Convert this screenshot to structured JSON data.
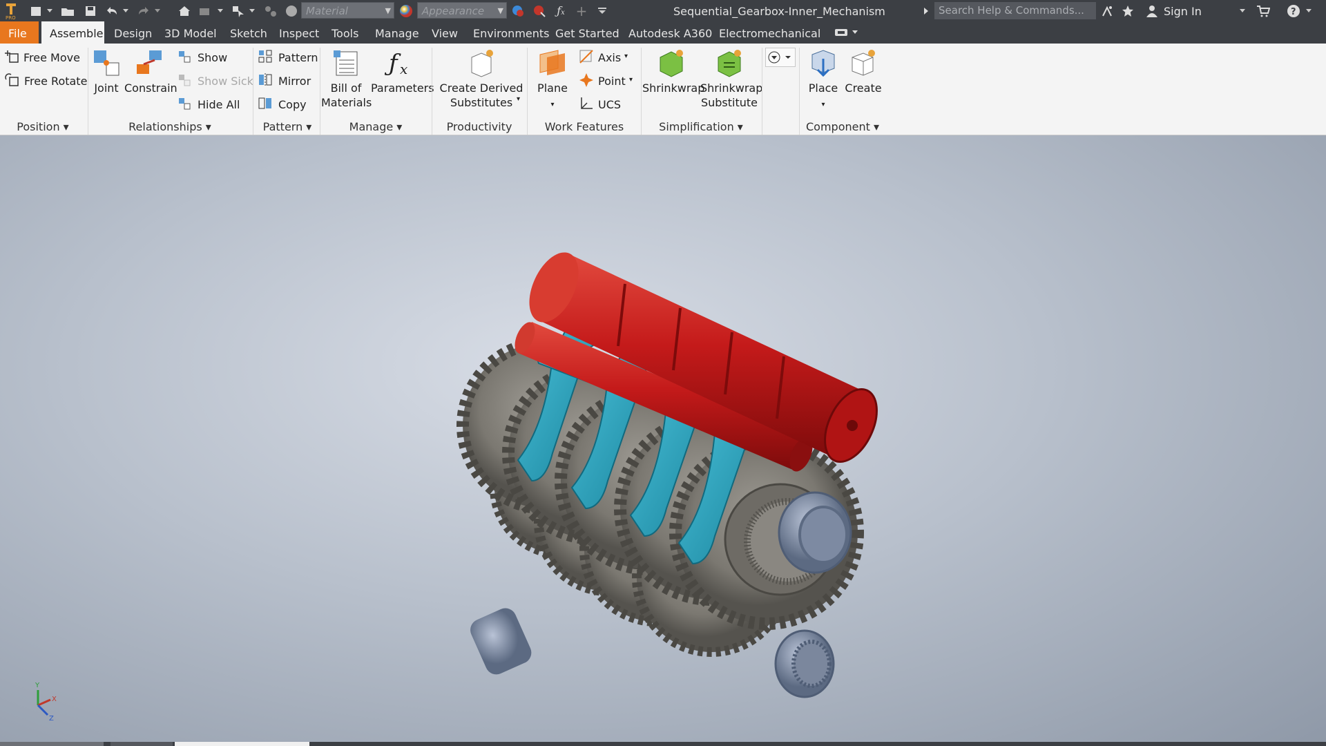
{
  "titlebar": {
    "material_placeholder": "Material",
    "appearance_placeholder": "Appearance",
    "document_title": "Sequential_Gearbox-Inner_Mechanism",
    "search_placeholder": "Search Help & Commands...",
    "sign_in": "Sign In"
  },
  "tabs": [
    "File",
    "Assemble",
    "Design",
    "3D Model",
    "Sketch",
    "Inspect",
    "Tools",
    "Manage",
    "View",
    "Environments",
    "Get Started",
    "Autodesk A360",
    "Electromechanical"
  ],
  "active_tab": "Assemble",
  "ribbon": {
    "position": {
      "free_move": "Free Move",
      "free_rotate": "Free Rotate",
      "label": "Position"
    },
    "relationships": {
      "joint": "Joint",
      "constrain": "Constrain",
      "show": "Show",
      "show_sick": "Show Sick",
      "hide_all": "Hide All",
      "label": "Relationships"
    },
    "pattern": {
      "pattern": "Pattern",
      "mirror": "Mirror",
      "copy": "Copy",
      "label": "Pattern"
    },
    "manage": {
      "bom_line1": "Bill of",
      "bom_line2": "Materials",
      "parameters": "Parameters",
      "label": "Manage"
    },
    "productivity": {
      "cds_line1": "Create Derived",
      "cds_line2": "Substitutes",
      "label": "Productivity"
    },
    "work_features": {
      "plane": "Plane",
      "axis": "Axis",
      "point": "Point",
      "ucs": "UCS",
      "label": "Work Features"
    },
    "simplification": {
      "shrinkwrap": "Shrinkwrap",
      "sws_line1": "Shrinkwrap",
      "sws_line2": "Substitute",
      "label": "Simplification"
    },
    "component": {
      "place": "Place",
      "create": "Create",
      "label": "Component"
    }
  },
  "viewport": {
    "model_name": "Sequential_Gearbox-Inner_Mechanism",
    "colors": {
      "shift_drum": "#c41a1a",
      "shift_forks": "#1ea3bf",
      "gears": "#7d7a74",
      "bearings": "#8594ad"
    },
    "triad_labels": {
      "x": "X",
      "y": "Y",
      "z": "Z"
    }
  },
  "colors": {
    "file_tab": "#e8771e",
    "chrome": "#3c3f44",
    "ribbon_bg": "#f4f4f4"
  }
}
